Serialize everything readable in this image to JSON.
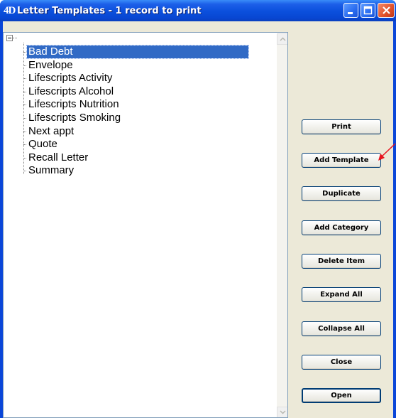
{
  "window": {
    "app_icon_text": "4D",
    "title": "Letter Templates - 1 record to print"
  },
  "tree": {
    "items": [
      {
        "label": "Bad Debt",
        "selected": true
      },
      {
        "label": "Envelope"
      },
      {
        "label": "Lifescripts Activity"
      },
      {
        "label": "Lifescripts Alcohol"
      },
      {
        "label": "Lifescripts Nutrition"
      },
      {
        "label": "Lifescripts Smoking"
      },
      {
        "label": "Next appt"
      },
      {
        "label": "Quote"
      },
      {
        "label": "Recall Letter"
      },
      {
        "label": "Summary"
      }
    ]
  },
  "buttons": {
    "print": "Print",
    "add_template": "Add Template",
    "duplicate": "Duplicate",
    "add_category": "Add Category",
    "delete_item": "Delete Item",
    "expand_all": "Expand All",
    "collapse_all": "Collapse All",
    "close": "Close",
    "open": "Open"
  },
  "colors": {
    "titlebar": "#0a4fdc",
    "selection": "#316ac5",
    "annotation_arrow": "#e8141e"
  }
}
